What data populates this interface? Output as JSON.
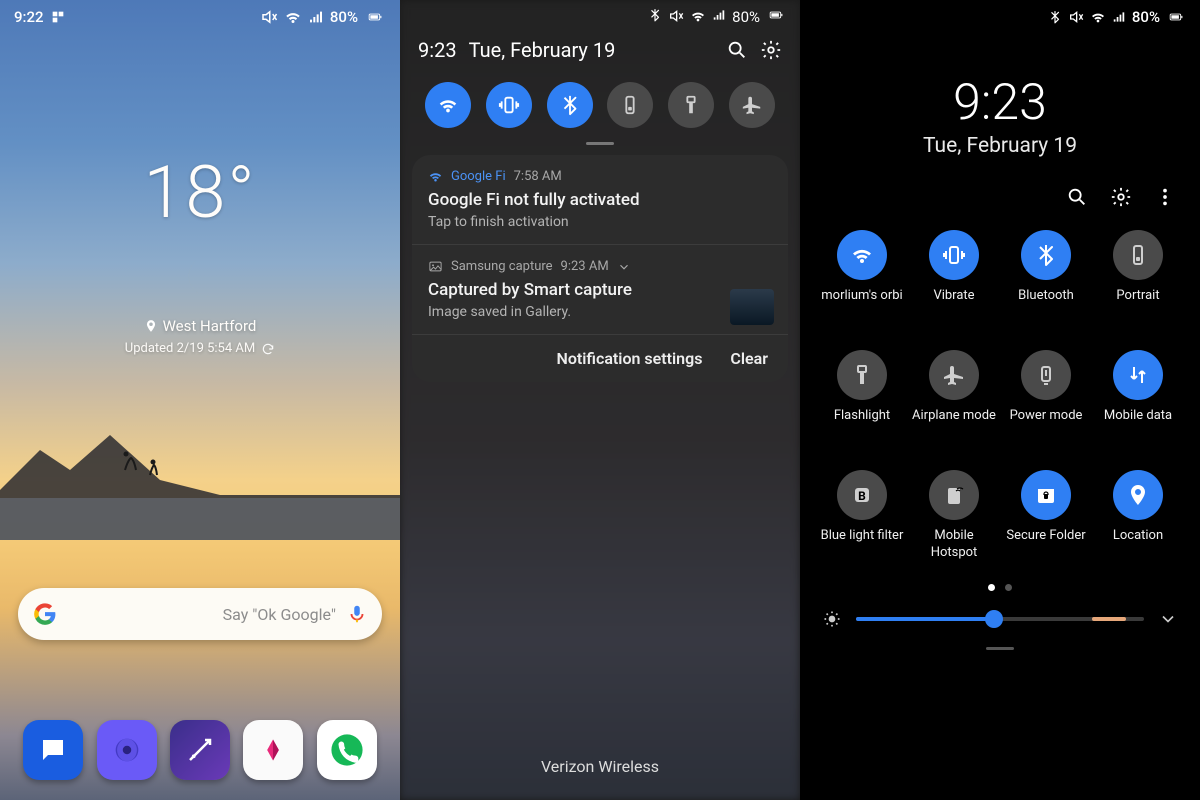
{
  "status": {
    "battery": "80%",
    "p1_time": "9:22",
    "p2_time_sb": ""
  },
  "home": {
    "temp": "18°",
    "location": "West Hartford",
    "updated": "Updated 2/19 5:54 AM",
    "search_hint": "Say \"Ok Google\""
  },
  "shade": {
    "time": "9:23",
    "date": "Tue, February 19",
    "toggles": [
      {
        "name": "wifi",
        "on": true
      },
      {
        "name": "vibrate",
        "on": true
      },
      {
        "name": "bluetooth",
        "on": true
      },
      {
        "name": "rotation",
        "on": false
      },
      {
        "name": "flashlight",
        "on": false
      },
      {
        "name": "airplane",
        "on": false
      }
    ],
    "notifications": [
      {
        "app": "Google Fi",
        "time": "7:58 AM",
        "title": "Google Fi not fully activated",
        "body": "Tap to finish activation",
        "thumb": false,
        "app_color": "#4b92f5"
      },
      {
        "app": "Samsung capture",
        "time": "9:23 AM",
        "title": "Captured by Smart capture",
        "body": "Image saved in Gallery.",
        "thumb": true,
        "app_color": "#a8a8a8"
      }
    ],
    "footer": {
      "settings": "Notification settings",
      "clear": "Clear"
    },
    "carrier": "Verizon Wireless"
  },
  "panel": {
    "time": "9:23",
    "date": "Tue, February 19",
    "tiles": [
      {
        "name": "wifi",
        "label": "morlium's orbi",
        "on": true
      },
      {
        "name": "vibrate",
        "label": "Vibrate",
        "on": true
      },
      {
        "name": "bluetooth",
        "label": "Bluetooth",
        "on": true
      },
      {
        "name": "portrait",
        "label": "Portrait",
        "on": false
      },
      {
        "name": "flashlight",
        "label": "Flashlight",
        "on": false
      },
      {
        "name": "airplane",
        "label": "Airplane mode",
        "on": false
      },
      {
        "name": "power",
        "label": "Power mode",
        "on": false
      },
      {
        "name": "mobiledata",
        "label": "Mobile data",
        "on": true
      },
      {
        "name": "bluelight",
        "label": "Blue light filter",
        "on": false
      },
      {
        "name": "hotspot",
        "label": "Mobile Hotspot",
        "on": false
      },
      {
        "name": "secure",
        "label": "Secure Folder",
        "on": true
      },
      {
        "name": "location",
        "label": "Location",
        "on": true
      }
    ],
    "brightness_pct": 48
  }
}
